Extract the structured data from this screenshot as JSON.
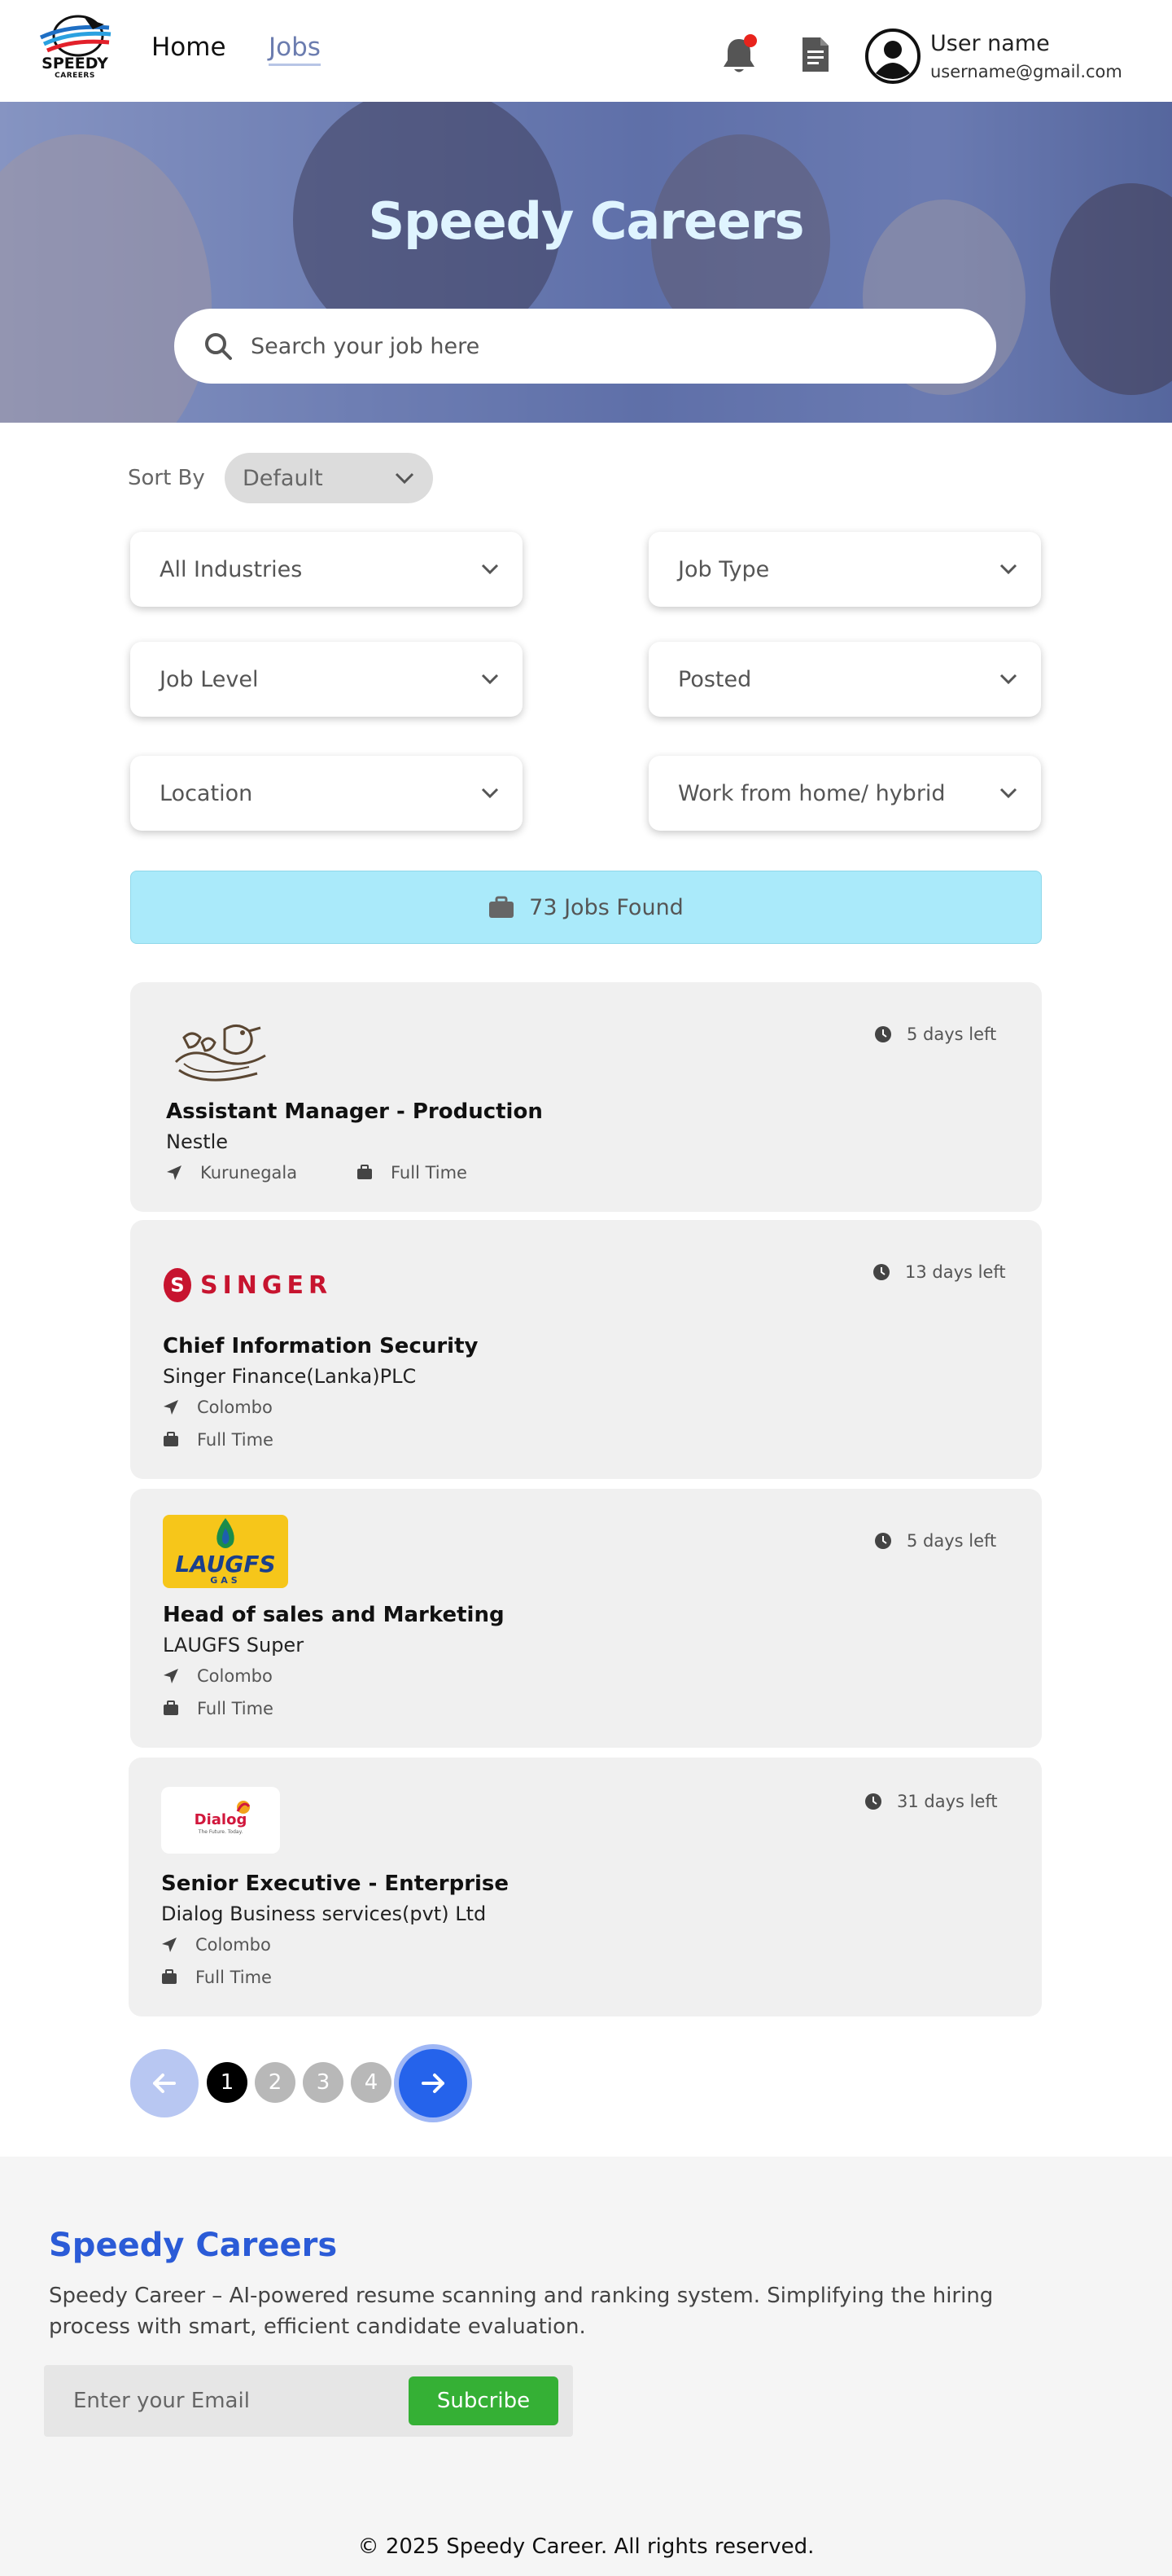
{
  "brand": {
    "logo_text": "SPEEDY",
    "logo_sub": "CAREERS"
  },
  "nav": {
    "home_label": "Home",
    "jobs_label": "Jobs"
  },
  "user": {
    "name": "User name",
    "email": "username@gmail.com"
  },
  "hero": {
    "title": "Speedy Careers",
    "search_placeholder": "Search your job here"
  },
  "sort": {
    "label": "Sort By",
    "value": "Default"
  },
  "filters": {
    "industries": "All Industries",
    "job_type": "Job Type",
    "job_level": "Job Level",
    "posted": "Posted",
    "location": "Location",
    "work_mode": "Work from home/ hybrid"
  },
  "results": {
    "found_text": "73 Jobs Found"
  },
  "jobs": [
    {
      "title": "Assistant Manager - Production",
      "company": "Nestle",
      "location": "Kurunegala",
      "type": "Full Time",
      "days_left": "5 days left",
      "logo": "nestle-logo"
    },
    {
      "title": "Chief Information Security",
      "company": "Singer Finance(Lanka)PLC",
      "location": "Colombo",
      "type": "Full Time",
      "days_left": "13 days left",
      "logo": "singer-logo",
      "logo_text": "SINGER"
    },
    {
      "title": "Head of sales and Marketing",
      "company": "LAUGFS Super",
      "location": "Colombo",
      "type": "Full Time",
      "days_left": "5 days left",
      "logo": "laugfs-logo",
      "logo_text": "LAUGFS",
      "logo_sub": "GAS"
    },
    {
      "title": "Senior Executive - Enterprise",
      "company": "Dialog Business services(pvt) Ltd",
      "location": "Colombo",
      "type": "Full Time",
      "days_left": "31 days left",
      "logo": "dialog-logo",
      "logo_text": "Dialog",
      "logo_sub": "The Future. Today."
    }
  ],
  "pagination": {
    "pages": [
      "1",
      "2",
      "3",
      "4"
    ],
    "current": "1"
  },
  "footer": {
    "title": "Speedy Careers",
    "description": "Speedy Career – AI-powered resume scanning and ranking system. Simplifying the hiring process with smart, efficient candidate evaluation.",
    "email_placeholder": "Enter your Email",
    "subscribe_label": "Subcribe",
    "copyright": "© 2025 Speedy Career. All rights reserved."
  },
  "colors": {
    "accent": "#2563eb",
    "found_bg": "#aaeafa",
    "subscribe": "#35b035",
    "footer_title": "#2b5bd7",
    "notification": "#e8231c"
  }
}
